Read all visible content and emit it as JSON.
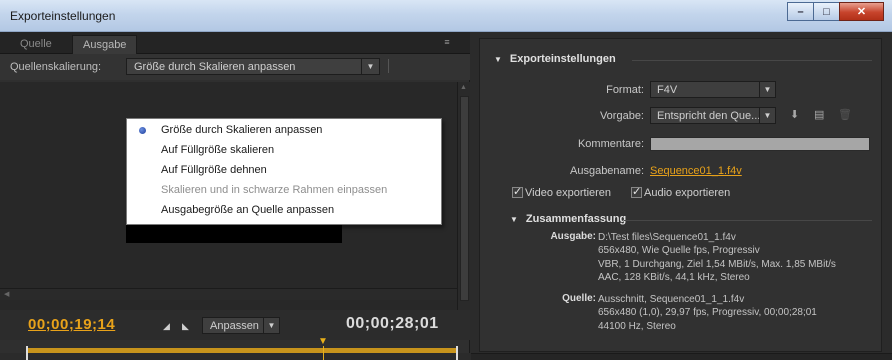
{
  "window": {
    "title": "Exporteinstellungen",
    "minimize": "–",
    "maximize": "□",
    "close": "✕"
  },
  "left": {
    "tabs": [
      {
        "label": "Quelle"
      },
      {
        "label": "Ausgabe"
      }
    ],
    "panel_menu_icon": "≡",
    "scaling_label": "Quellenskalierung:",
    "scaling_value": "Größe durch Skalieren anpassen",
    "menu_items": [
      {
        "label": "Größe durch Skalieren anpassen",
        "selected": true,
        "enabled": true
      },
      {
        "label": "Auf Füllgröße skalieren",
        "selected": false,
        "enabled": true
      },
      {
        "label": "Auf Füllgröße dehnen",
        "selected": false,
        "enabled": true
      },
      {
        "label": "Skalieren und in schwarze Rahmen einpassen",
        "selected": false,
        "enabled": false
      },
      {
        "label": "Ausgabegröße an Quelle anpassen",
        "selected": false,
        "enabled": true
      }
    ],
    "timecode_current": "00;00;19;14",
    "timecode_duration": "00;00;28;01",
    "fit_value": "Anpassen"
  },
  "right": {
    "export_section": "Exporteinstellungen",
    "format_label": "Format:",
    "format_value": "F4V",
    "preset_label": "Vorgabe:",
    "preset_value": "Entspricht den Que...",
    "comments_label": "Kommentare:",
    "output_name_label": "Ausgabename:",
    "output_name_value": "Sequence01_1.f4v",
    "export_video_label": "Video exportieren",
    "export_audio_label": "Audio exportieren",
    "export_video_checked": true,
    "export_audio_checked": true,
    "summary_section": "Zusammenfassung",
    "summary_output_key": "Ausgabe:",
    "summary_output_value": "D:\\Test files\\Sequence01_1.f4v\n656x480, Wie Quelle fps, Progressiv\nVBR, 1 Durchgang, Ziel 1,54 MBit/s, Max. 1,85 MBit/s\nAAC, 128 KBit/s, 44,1 kHz, Stereo",
    "summary_source_key": "Quelle:",
    "summary_source_value": "Ausschnitt, Sequence01_1_1.f4v\n656x480 (1,0), 29,97 fps, Progressiv, 00;00;28;01\n44100 Hz, Stereo"
  },
  "colors": {
    "accent_orange": "#e8a21a",
    "panel_bg": "#313131",
    "menu_bg": "#ffffff"
  },
  "icons": [
    "save-preset-icon",
    "import-preset-icon",
    "delete-preset-icon",
    "panel-menu-icon",
    "mark-in-icon",
    "mark-out-icon",
    "playhead-icon"
  ]
}
